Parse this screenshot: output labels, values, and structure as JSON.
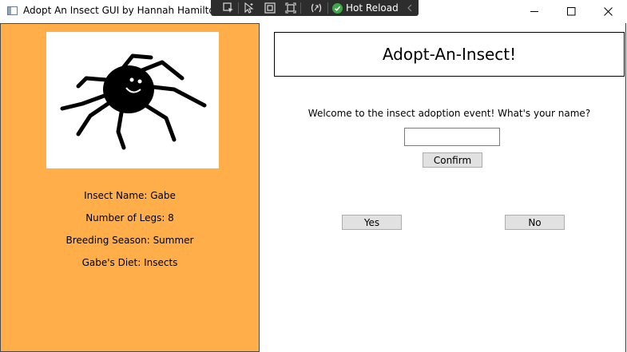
{
  "window": {
    "title": "Adopt An Insect GUI by Hannah Hamilton"
  },
  "dev_toolbar": {
    "icons": [
      "select-element-icon",
      "pointer-icon",
      "display-layout-adorners-icon",
      "track-focus-icon",
      "binding-failures-icon"
    ],
    "hot_reload_label": "Hot Reload"
  },
  "colors": {
    "left_panel_bg": "#ffae4a",
    "button_bg": "#e1e1e1",
    "hot_reload_check": "#3fa64a"
  },
  "insect_info": {
    "name_line": "Insect Name: Gabe",
    "legs_line": "Number of Legs: 8",
    "season_line": "Breeding Season: Summer",
    "diet_line": "Gabe's Diet: Insects"
  },
  "main": {
    "header": "Adopt-An-Insect!",
    "welcome": "Welcome to the insect adoption event! What's your name?",
    "name_input_value": "",
    "confirm_label": "Confirm",
    "yes_label": "Yes",
    "no_label": "No"
  }
}
